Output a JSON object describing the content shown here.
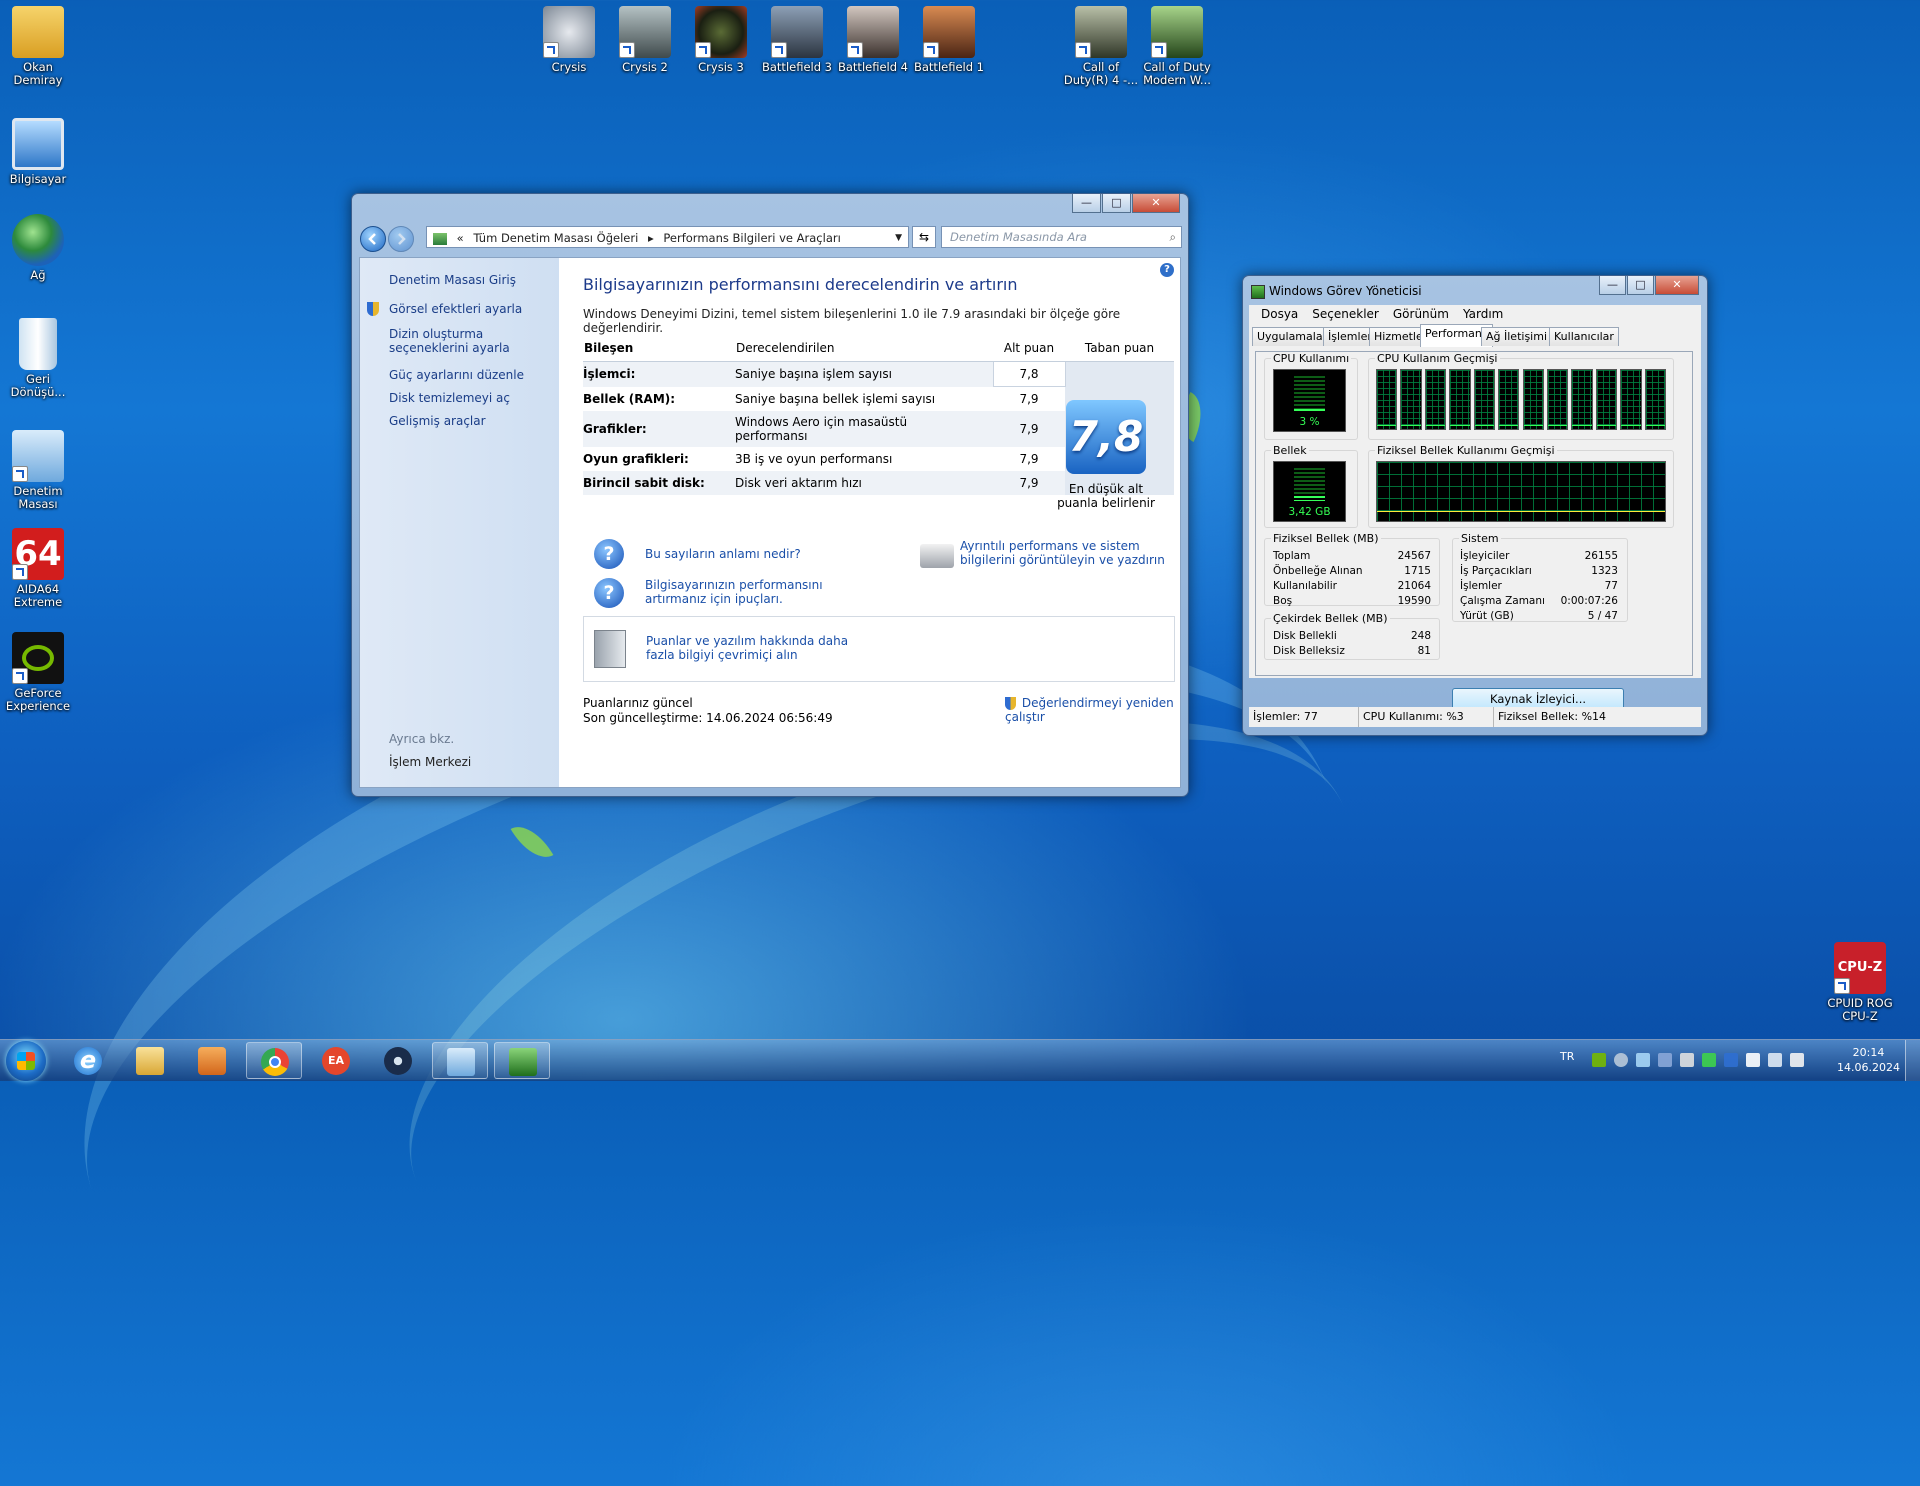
{
  "desktop": {
    "icons": [
      {
        "label": "Okan Demiray",
        "icon": "user-folder-icon",
        "color": "#e9b941"
      },
      {
        "label": "Bilgisayar",
        "icon": "computer-icon",
        "color": "#5aa0e6"
      },
      {
        "label": "Ağ",
        "icon": "network-globe-icon",
        "color": "#3a8fd6"
      },
      {
        "label": "Geri Dönüşü...",
        "icon": "recycle-bin-icon",
        "color": "#b9d5ec"
      },
      {
        "label": "Denetim Masası",
        "icon": "control-panel-icon",
        "color": "#7cb4e6"
      },
      {
        "label": "AIDA64 Extreme",
        "icon": "aida64-icon",
        "color": "#d21d1d"
      },
      {
        "label": "GeForce Experience",
        "icon": "geforce-icon",
        "color": "#76b900"
      },
      {
        "label": "Crysis",
        "icon": "crysis-icon",
        "color": "#b9c0c8"
      },
      {
        "label": "Crysis 2",
        "icon": "crysis2-icon",
        "color": "#7d8d8f"
      },
      {
        "label": "Crysis 3",
        "icon": "crysis3-icon",
        "color": "#a33c25"
      },
      {
        "label": "Battlefield 3",
        "icon": "battlefield3-icon",
        "color": "#4d5b6e"
      },
      {
        "label": "Battlefield 4",
        "icon": "battlefield4-icon",
        "color": "#6b5c55"
      },
      {
        "label": "Battlefield 1",
        "icon": "battlefield1-icon",
        "color": "#a35a32"
      },
      {
        "label": "Call of Duty(R) 4 -...",
        "icon": "cod4-icon",
        "color": "#5d6a52"
      },
      {
        "label": "Call of Duty Modern W...",
        "icon": "cod-mw2-icon",
        "color": "#4e7d3a"
      },
      {
        "label": "CPUID ROG CPU-Z",
        "icon": "cpuz-icon",
        "color": "#c8202a"
      }
    ],
    "aida_text": "64",
    "cpuz_text": "CPU-Z"
  },
  "control_panel": {
    "breadcrumb_prefix": "«",
    "breadcrumb": [
      "Tüm Denetim Masası Öğeleri",
      "Performans Bilgileri ve Araçları"
    ],
    "search_placeholder": "Denetim Masasında Ara",
    "sidebar": {
      "home": "Denetim Masası Giriş",
      "links": [
        "Görsel efektleri ayarla",
        "Dizin oluşturma seçeneklerini ayarla",
        "Güç ayarlarını düzenle",
        "Disk temizlemeyi aç",
        "Gelişmiş araçlar"
      ],
      "see_also_label": "Ayrıca bkz.",
      "see_also": "İşlem Merkezi"
    },
    "title": "Bilgisayarınızın performansını derecelendirin ve artırın",
    "description": "Windows Deneyimi Dizini, temel sistem bileşenlerini 1.0 ile 7.9 arasındaki bir ölçeğe göre değerlendirir.",
    "table": {
      "headers": [
        "Bileşen",
        "Derecelendirilen",
        "Alt puan",
        "Taban puan"
      ],
      "rows": [
        {
          "component": "İşlemci:",
          "rated": "Saniye başına işlem sayısı",
          "score": "7,8"
        },
        {
          "component": "Bellek (RAM):",
          "rated": "Saniye başına bellek işlemi sayısı",
          "score": "7,9"
        },
        {
          "component": "Grafikler:",
          "rated": "Windows Aero için masaüstü performansı",
          "score": "7,9"
        },
        {
          "component": "Oyun grafikleri:",
          "rated": "3B iş ve oyun performansı",
          "score": "7,9"
        },
        {
          "component": "Birincil sabit disk:",
          "rated": "Disk veri aktarım hızı",
          "score": "7,9"
        }
      ],
      "base_score": "7,8",
      "base_caption": "En düşük alt puanla belirlenir"
    },
    "links": {
      "what_mean": "Bu sayıların anlamı nedir?",
      "tips": "Bilgisayarınızın performansını artırmanız için ipuçları.",
      "details": "Ayrıntılı performans ve sistem bilgilerini görüntüleyin ve yazdırın",
      "more_online": "Puanlar ve yazılım hakkında daha fazla bilgiyi çevrimiçi alın",
      "rerun": "Değerlendirmeyi yeniden çalıştır"
    },
    "status": {
      "current": "Puanlarınız güncel",
      "last_update": "Son güncelleştirme: 14.06.2024 06:56:49"
    }
  },
  "task_manager": {
    "title": "Windows Görev Yöneticisi",
    "menu": [
      "Dosya",
      "Seçenekler",
      "Görünüm",
      "Yardım"
    ],
    "tabs": [
      "Uygulamalar",
      "İşlemler",
      "Hizmetler",
      "Performans",
      "Ağ İletişimi",
      "Kullanıcılar"
    ],
    "active_tab": "Performans",
    "cpu_usage_label": "CPU Kullanımı",
    "cpu_usage_value": "3 %",
    "cpu_usage_fraction": 0.03,
    "cpu_history_label": "CPU Kullanım Geçmişi",
    "memory_label": "Bellek",
    "memory_value": "3,42 GB",
    "memory_fraction": 0.14,
    "memory_history_label": "Fiziksel Bellek Kullanımı Geçmişi",
    "physical_memory": {
      "title": "Fiziksel Bellek (MB)",
      "rows": [
        [
          "Toplam",
          "24567"
        ],
        [
          "Önbelleğe Alınan",
          "1715"
        ],
        [
          "Kullanılabilir",
          "21064"
        ],
        [
          "Boş",
          "19590"
        ]
      ]
    },
    "kernel_memory": {
      "title": "Çekirdek Bellek (MB)",
      "rows": [
        [
          "Disk Bellekli",
          "248"
        ],
        [
          "Disk Belleksiz",
          "81"
        ]
      ]
    },
    "system": {
      "title": "Sistem",
      "rows": [
        [
          "İşleyiciler",
          "26155"
        ],
        [
          "İş Parçacıkları",
          "1323"
        ],
        [
          "İşlemler",
          "77"
        ],
        [
          "Çalışma Zamanı",
          "0:00:07:26"
        ],
        [
          "Yürüt (GB)",
          "5 / 47"
        ]
      ]
    },
    "resource_button": "Kaynak İzleyici...",
    "statusbar": [
      "İşlemler: 77",
      "CPU Kullanımı: %3",
      "Fiziksel Bellek: %14"
    ]
  },
  "taskbar": {
    "pinned": [
      {
        "name": "internet-explorer",
        "icon": "ie-icon",
        "color": "#2d8fe6",
        "open": false
      },
      {
        "name": "explorer",
        "icon": "folder-icon",
        "color": "#e8c25a",
        "open": false
      },
      {
        "name": "media-player",
        "icon": "media-player-icon",
        "color": "#f08a2a",
        "open": false
      },
      {
        "name": "chrome",
        "icon": "chrome-icon",
        "color": "#e2a81f",
        "open": true
      },
      {
        "name": "ea",
        "icon": "ea-icon",
        "color": "#e4462b",
        "open": false
      },
      {
        "name": "steam",
        "icon": "steam-icon",
        "color": "#1a2c4a",
        "open": false
      },
      {
        "name": "control-panel",
        "icon": "control-panel-icon",
        "color": "#7cb4e6",
        "open": true
      },
      {
        "name": "task-manager",
        "icon": "task-manager-icon",
        "color": "#3e8c3e",
        "open": true
      }
    ],
    "ie_glyph": "e",
    "ea_glyph": "EA",
    "language": "TR",
    "time": "20:14",
    "date": "14.06.2024"
  },
  "window_controls": {
    "minimize": "—",
    "maximize": "□",
    "close": "✕"
  }
}
